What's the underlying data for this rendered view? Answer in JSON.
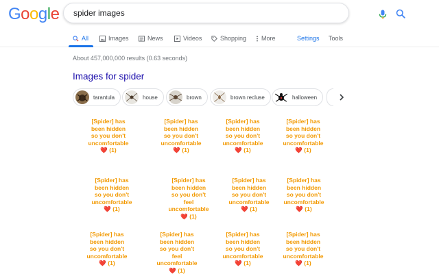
{
  "logo": {
    "letters": [
      "G",
      "o",
      "o",
      "g",
      "l",
      "e"
    ],
    "colors": [
      "#4285f4",
      "#ea4335",
      "#fbbc05",
      "#4285f4",
      "#34a853",
      "#ea4335"
    ]
  },
  "search": {
    "query": "spider images"
  },
  "tabs": [
    {
      "label": "All",
      "icon": "search-icon",
      "active": true
    },
    {
      "label": "Images",
      "icon": "image-icon"
    },
    {
      "label": "News",
      "icon": "news-icon"
    },
    {
      "label": "Videos",
      "icon": "video-icon"
    },
    {
      "label": "Shopping",
      "icon": "tag-icon"
    },
    {
      "label": "More",
      "icon": "more-vertical-icon"
    },
    {
      "label": "Settings"
    },
    {
      "label": "Tools"
    }
  ],
  "results_stats": "About 457,000,000 results (0.63 seconds)",
  "images_heading": "Images for spider",
  "chips": [
    {
      "label": "tarantula"
    },
    {
      "label": "house"
    },
    {
      "label": "brown"
    },
    {
      "label": "brown recluse"
    },
    {
      "label": "halloween"
    }
  ],
  "hidden_card": {
    "line1": "[Spider] has",
    "line2": "been hidden",
    "line3": "so you don't",
    "line4": "feel",
    "line5": "uncomfortable",
    "heart": "❤️",
    "count": "(1)"
  },
  "colors": {
    "accent": "#1a73e8",
    "link": "#1a0dab",
    "warning": "#f29900"
  }
}
